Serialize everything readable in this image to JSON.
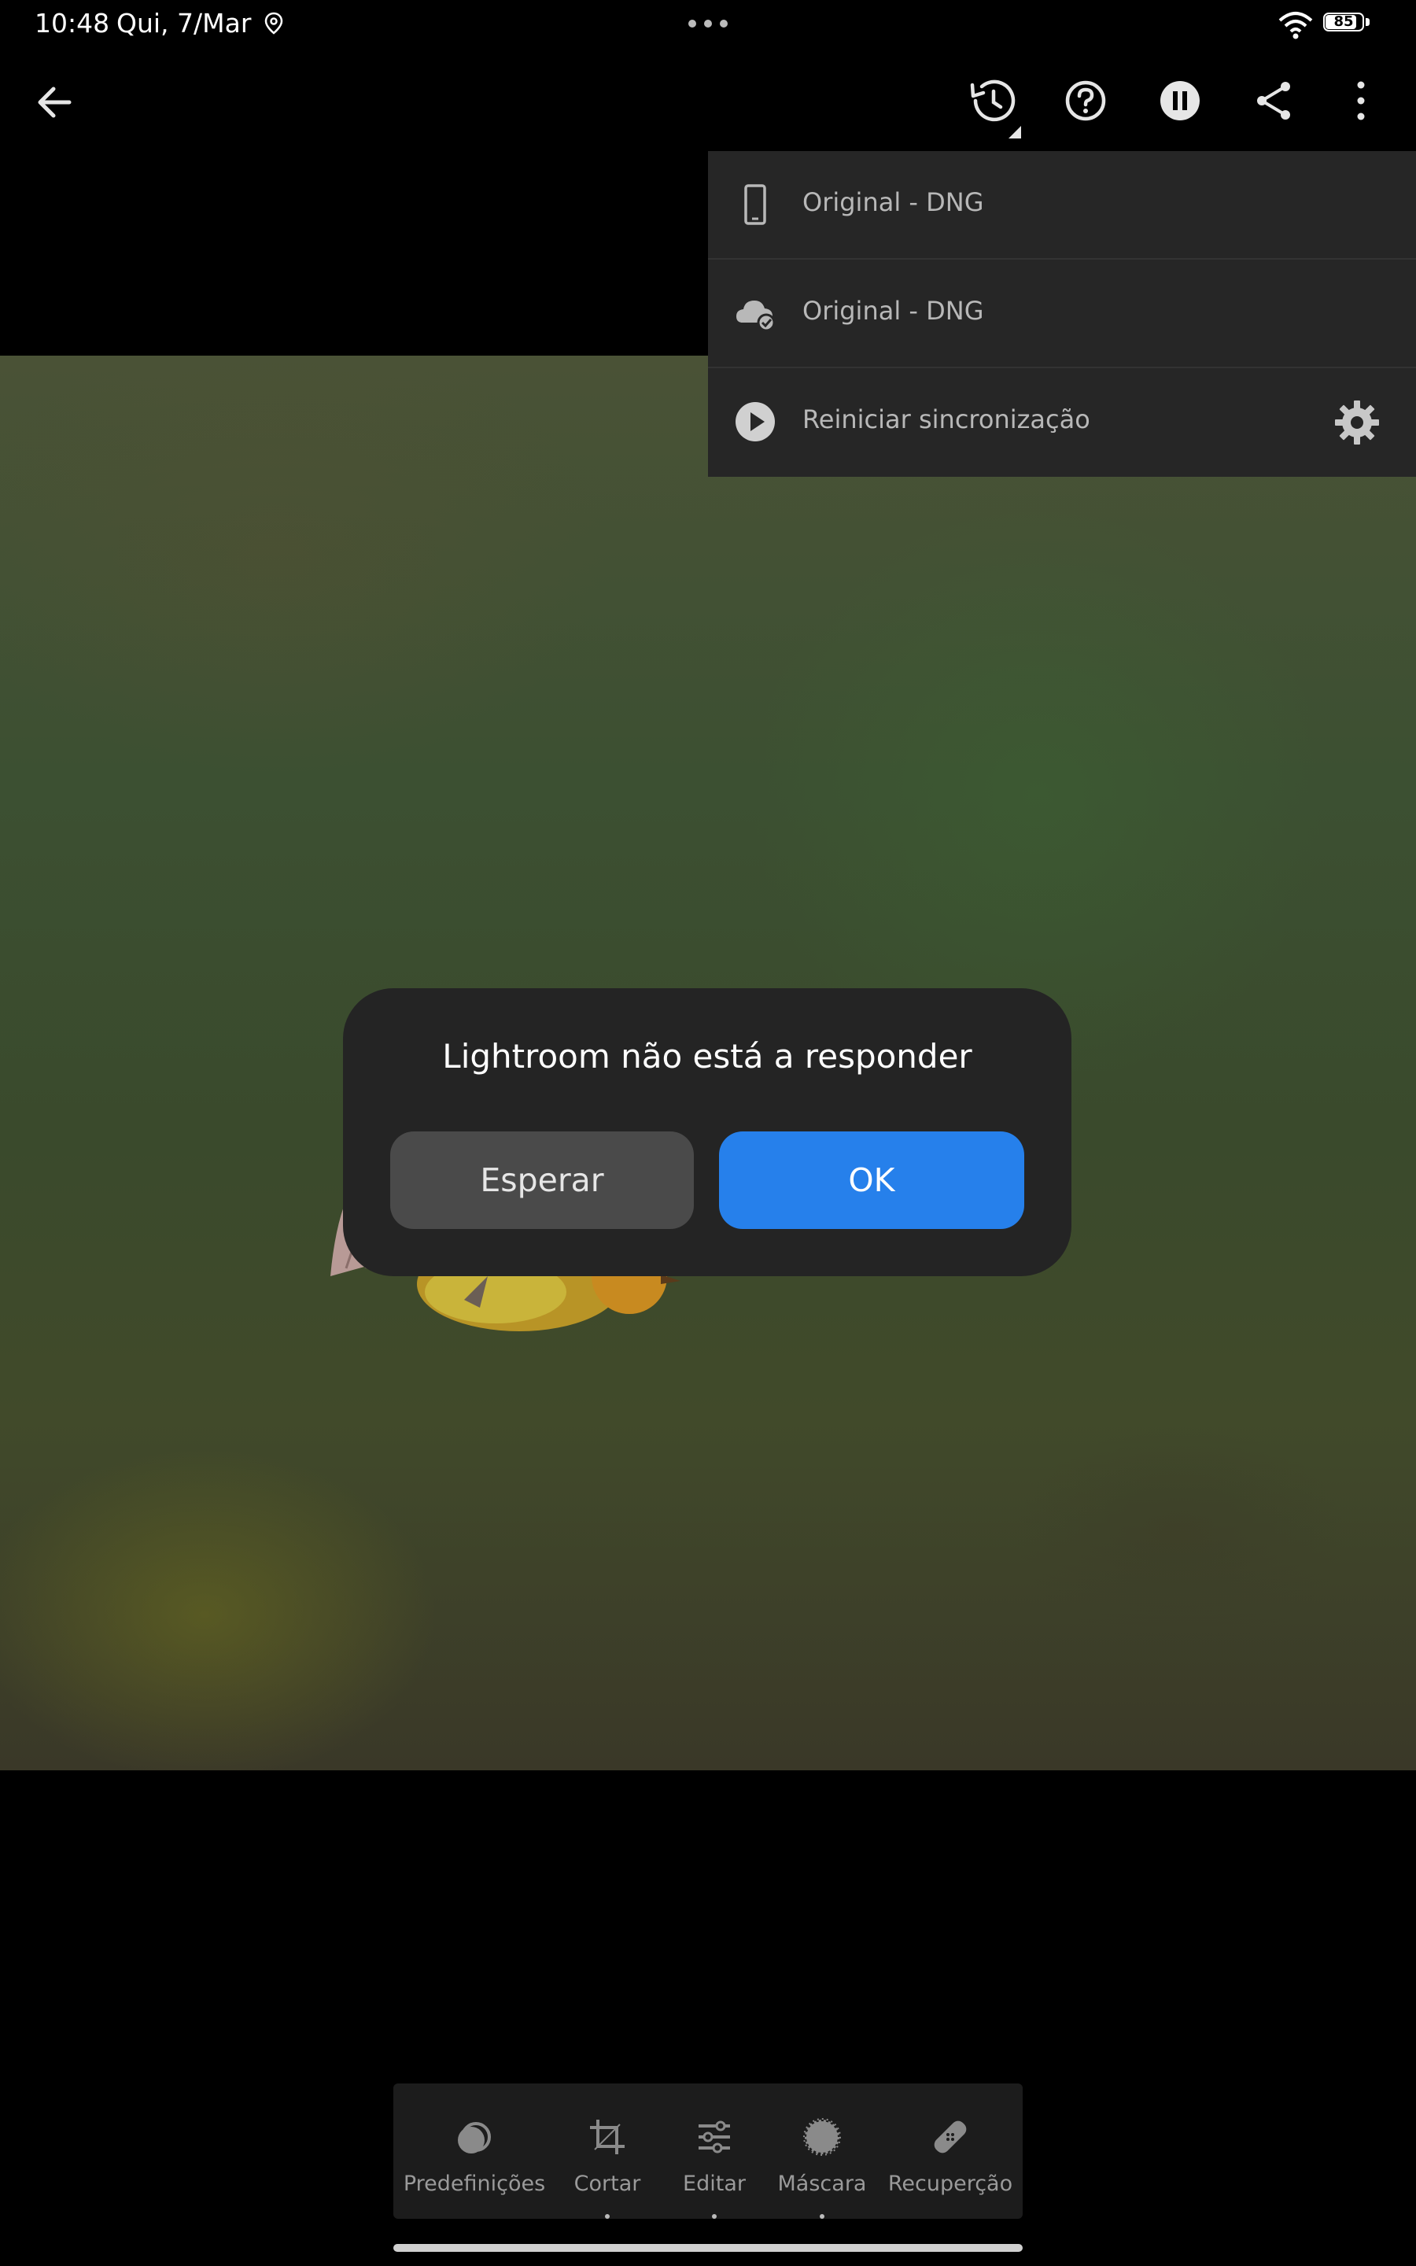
{
  "status_bar": {
    "time": "10:48",
    "date": "Qui, 7/Mar",
    "battery": "85",
    "battery_level": 0.85
  },
  "top_bar": {
    "icons": [
      "back-arrow-icon",
      "history-icon",
      "help-icon",
      "pause-icon",
      "share-icon",
      "more-vertical-icon"
    ]
  },
  "menu": {
    "items": [
      {
        "label": "Original - DNG",
        "icon": "phone-icon"
      },
      {
        "label": "Original - DNG",
        "icon": "cloud-check-icon"
      },
      {
        "label": "Reiniciar sincronização",
        "icon": "play-circle-icon"
      }
    ]
  },
  "dialog": {
    "title": "Lightroom não está a responder",
    "wait_label": "Esperar",
    "ok_label": "OK",
    "ok_color": "#2680eb"
  },
  "toolbar": {
    "items": [
      {
        "label": "Predefinições",
        "icon": "presets-icon"
      },
      {
        "label": "Cortar",
        "icon": "crop-icon"
      },
      {
        "label": "Editar",
        "icon": "sliders-icon"
      },
      {
        "label": "Máscara",
        "icon": "mask-icon"
      },
      {
        "label": "Recuperção",
        "icon": "healing-bandage-icon"
      }
    ]
  }
}
